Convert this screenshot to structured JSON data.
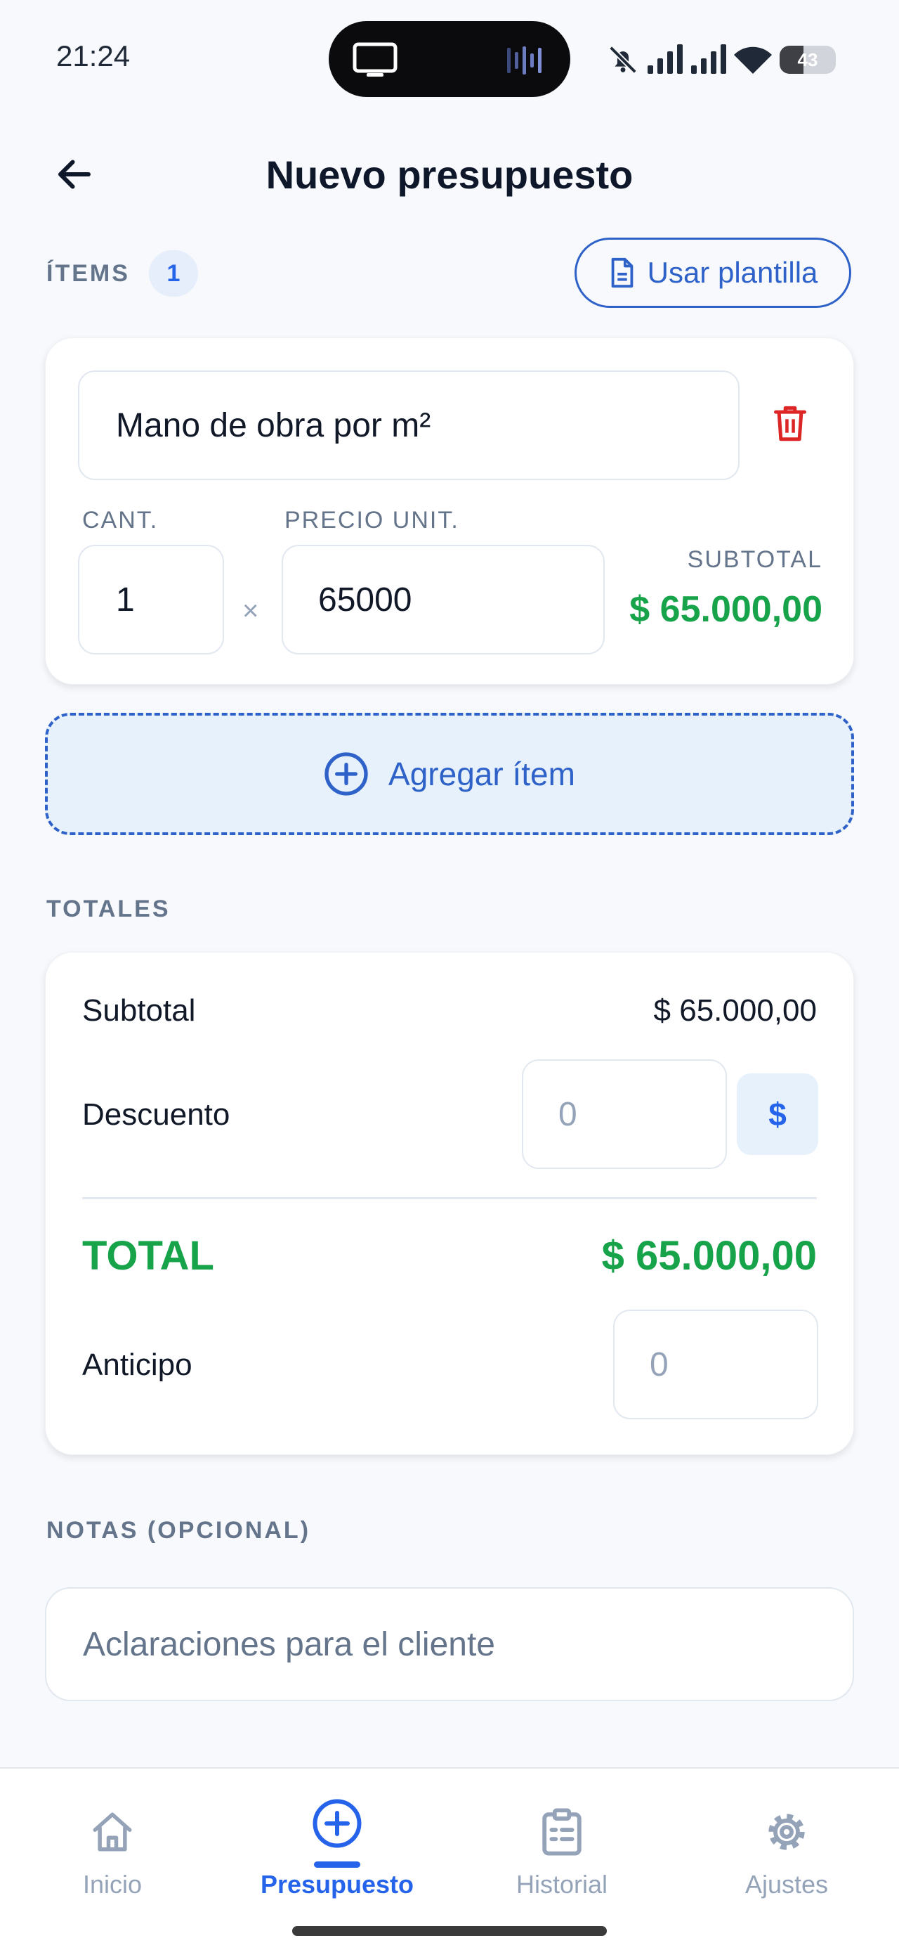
{
  "status_bar": {
    "time": "21:24",
    "battery": "43",
    "icons": [
      "tv-icon",
      "audio-wave-icon",
      "bell-off-icon",
      "signal-icon",
      "signal-icon",
      "wifi-icon",
      "battery-icon"
    ]
  },
  "header": {
    "title": "Nuevo presupuesto",
    "back_icon": "arrow-left-icon"
  },
  "items_section": {
    "label": "ÍTEMS",
    "count": "1",
    "template_button": "Usar plantilla",
    "items": [
      {
        "name": "Mano de obra por m²",
        "qty_label": "CANT.",
        "qty": "1",
        "times": "×",
        "price_label": "PRECIO UNIT.",
        "price": "65000",
        "subtotal_label": "SUBTOTAL",
        "subtotal": "$ 65.000,00"
      }
    ],
    "add_button": "Agregar ítem"
  },
  "totals": {
    "label": "TOTALES",
    "subtotal_label": "Subtotal",
    "subtotal_value": "$ 65.000,00",
    "discount_label": "Descuento",
    "discount_placeholder": "0",
    "currency_toggle": "$",
    "total_label": "TOTAL",
    "total_value": "$ 65.000,00",
    "advance_label": "Anticipo",
    "advance_placeholder": "0"
  },
  "notes": {
    "label": "NOTAS (OPCIONAL)",
    "placeholder": "Aclaraciones para el cliente"
  },
  "nav": {
    "items": [
      {
        "label": "Inicio",
        "icon": "home-icon",
        "active": false
      },
      {
        "label": "Presupuesto",
        "icon": "plus-circle-icon",
        "active": true
      },
      {
        "label": "Historial",
        "icon": "clipboard-list-icon",
        "active": false
      },
      {
        "label": "Ajustes",
        "icon": "gear-icon",
        "active": false
      }
    ]
  },
  "colors": {
    "accent": "#2563eb",
    "success": "#17a34a",
    "danger": "#dc2626",
    "muted": "#64748b"
  }
}
